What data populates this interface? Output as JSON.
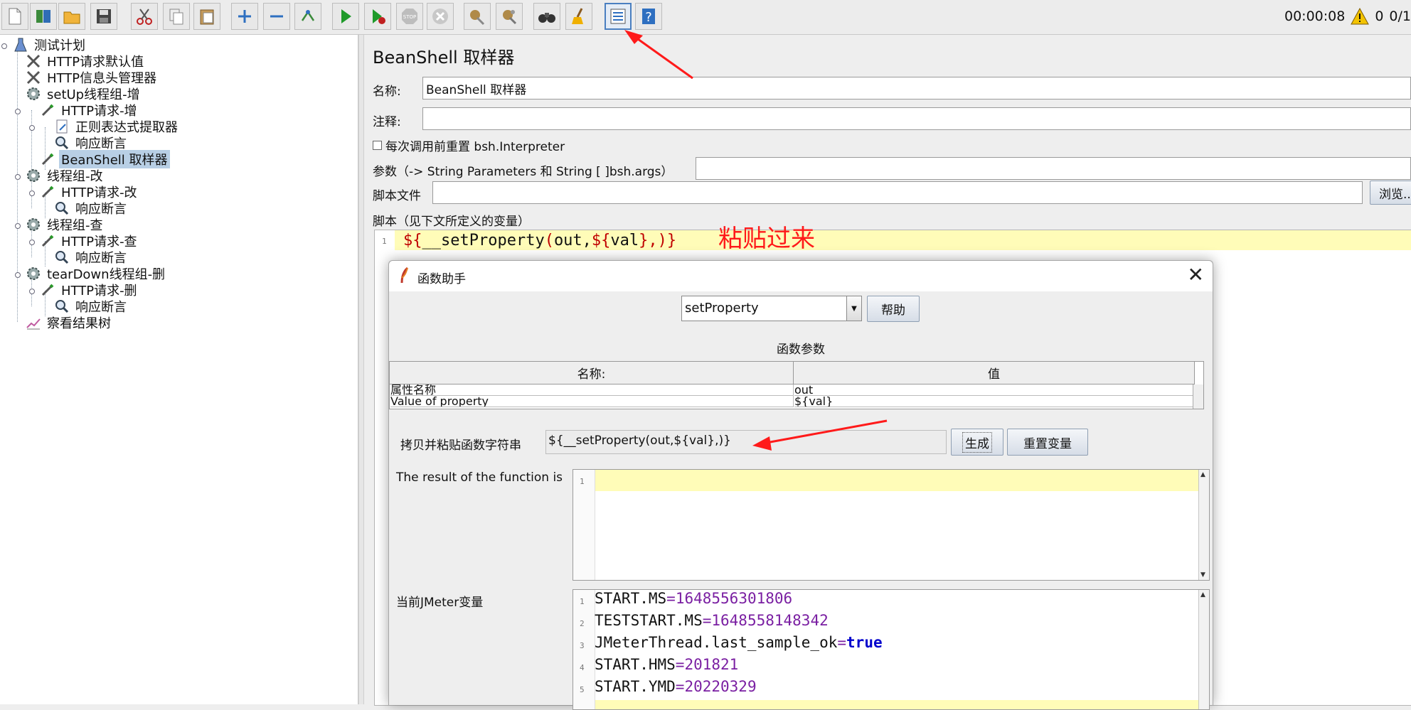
{
  "toolbar": {
    "timer": "00:00:08",
    "warning_count": "0",
    "threads": "0/1"
  },
  "tree": {
    "nodes": [
      {
        "label": "测试计划"
      },
      {
        "label": "HTTP请求默认值"
      },
      {
        "label": "HTTP信息头管理器"
      },
      {
        "label": "setUp线程组-增"
      },
      {
        "label": "HTTP请求-增"
      },
      {
        "label": "正则表达式提取器"
      },
      {
        "label": "响应断言"
      },
      {
        "label": "BeanShell 取样器"
      },
      {
        "label": "线程组-改"
      },
      {
        "label": "HTTP请求-改"
      },
      {
        "label": "响应断言"
      },
      {
        "label": "线程组-查"
      },
      {
        "label": "HTTP请求-查"
      },
      {
        "label": "响应断言"
      },
      {
        "label": "tearDown线程组-删"
      },
      {
        "label": "HTTP请求-删"
      },
      {
        "label": "响应断言"
      },
      {
        "label": "察看结果树"
      }
    ]
  },
  "panel": {
    "title": "BeanShell 取样器",
    "name_label": "名称:",
    "name_value": "BeanShell 取样器",
    "comment_label": "注释:",
    "reset_interpreter_label": "每次调用前重置 bsh.Interpreter",
    "params_label": "参数（-> String Parameters 和 String [ ]bsh.args）",
    "script_file_label": "脚本文件",
    "browse_label": "浏览...",
    "script_label": "脚本（见下文所定义的变量）",
    "script_line_no": "1",
    "script_code": {
      "p1": "${",
      "p2": "__setProperty",
      "p3": "(",
      "p4": "out,",
      "p5": "${",
      "p6": "val",
      "p7": "}",
      "p8": ",)",
      "p9": "}"
    },
    "annotation": "粘贴过来"
  },
  "dialog": {
    "title": "函数助手",
    "function_selected": "setProperty",
    "help_button": "帮助",
    "params_caption": "函数参数",
    "table_headers": [
      "名称:",
      "值"
    ],
    "table_rows": [
      {
        "name": "属性名称",
        "value": "out"
      },
      {
        "name": "Value of property",
        "value": "${val}"
      }
    ],
    "copy_label": "拷贝并粘贴函数字符串",
    "copy_value": "${__setProperty(out,${val},)}",
    "generate_button": "生成",
    "reset_vars_button": "重置变量",
    "result_label": "The result of the function is",
    "result_line_no": "1",
    "vars_label": "当前JMeter变量",
    "vars": [
      {
        "no": "1",
        "key": "START.MS",
        "eq": "=",
        "value": "1648556301806"
      },
      {
        "no": "2",
        "key": "TESTSTART.MS",
        "eq": "=",
        "value": "1648558148342"
      },
      {
        "no": "3",
        "key": "JMeterThread.last_sample_ok",
        "eq": "=",
        "value": "true"
      },
      {
        "no": "4",
        "key": "START.HMS",
        "eq": "=",
        "value": "201821"
      },
      {
        "no": "5",
        "key": "START.YMD",
        "eq": "=",
        "value": "20220329"
      }
    ]
  },
  "colors": {
    "annotation_red": "#ff1a1a",
    "selection": "#b8cfe5",
    "current_line": "#fffcb8"
  }
}
